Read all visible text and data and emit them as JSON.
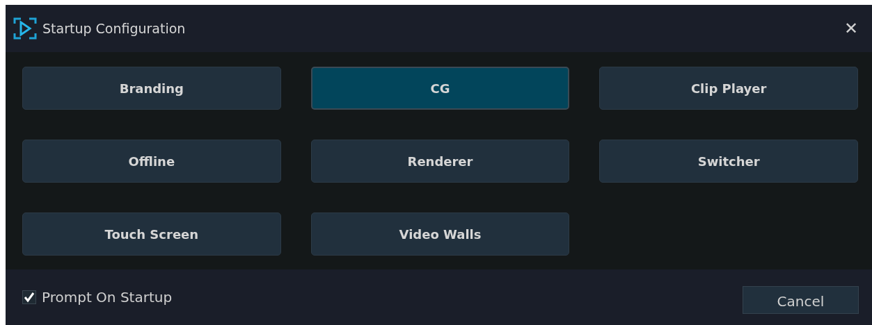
{
  "window": {
    "title": "Startup Configuration",
    "close": "✕"
  },
  "options": [
    {
      "label": "Branding",
      "selected": false
    },
    {
      "label": "CG",
      "selected": true
    },
    {
      "label": "Clip Player",
      "selected": false
    },
    {
      "label": "Offline",
      "selected": false
    },
    {
      "label": "Renderer",
      "selected": false
    },
    {
      "label": "Switcher",
      "selected": false
    },
    {
      "label": "Touch Screen",
      "selected": false
    },
    {
      "label": "Video Walls",
      "selected": false
    }
  ],
  "prompt_on_startup": {
    "label": "Prompt On Startup",
    "checked": true
  },
  "buttons": [
    "Cancel"
  ]
}
